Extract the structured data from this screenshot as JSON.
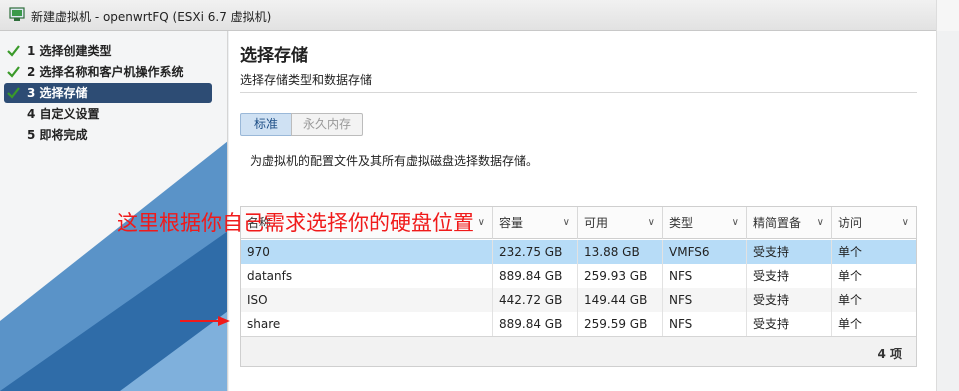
{
  "window": {
    "title": "新建虚拟机 - openwrtFQ (ESXi 6.7 虚拟机)",
    "icon": "vm-icon"
  },
  "sidebar": {
    "steps": [
      {
        "label": "1 选择创建类型",
        "done": true,
        "active": false
      },
      {
        "label": "2 选择名称和客户机操作系统",
        "done": true,
        "active": false
      },
      {
        "label": "3 选择存储",
        "done": true,
        "active": true
      },
      {
        "label": "4 自定义设置",
        "done": false,
        "active": false
      },
      {
        "label": "5 即将完成",
        "done": false,
        "active": false
      }
    ]
  },
  "main": {
    "title": "选择存储",
    "subtitle": "选择存储类型和数据存储",
    "tabs": [
      {
        "label": "标准",
        "selected": true
      },
      {
        "label": "永久内存",
        "selected": false
      }
    ],
    "description": "为虚拟机的配置文件及其所有虚拟磁盘选择数据存储。",
    "table": {
      "columns": [
        "名称",
        "容量",
        "可用",
        "类型",
        "精简置备",
        "访问"
      ],
      "rows": [
        {
          "name": "970",
          "capacity": "232.75 GB",
          "free": "13.88 GB",
          "type": "VMFS6",
          "thin": "受支持",
          "access": "单个",
          "selected": true
        },
        {
          "name": "datanfs",
          "capacity": "889.84 GB",
          "free": "259.93 GB",
          "type": "NFS",
          "thin": "受支持",
          "access": "单个",
          "selected": false
        },
        {
          "name": "ISO",
          "capacity": "442.72 GB",
          "free": "149.44 GB",
          "type": "NFS",
          "thin": "受支持",
          "access": "单个",
          "selected": false
        },
        {
          "name": "share",
          "capacity": "889.84 GB",
          "free": "259.59 GB",
          "type": "NFS",
          "thin": "受支持",
          "access": "单个",
          "selected": false
        }
      ],
      "footer": "4 项"
    }
  },
  "annotation": {
    "text": "这里根据你自己需求选择你的硬盘位置",
    "color": "#f01a1a"
  },
  "colors": {
    "accent": "#2d4c74",
    "selected_row": "#b7dcf7",
    "check": "#3a9a2a"
  }
}
